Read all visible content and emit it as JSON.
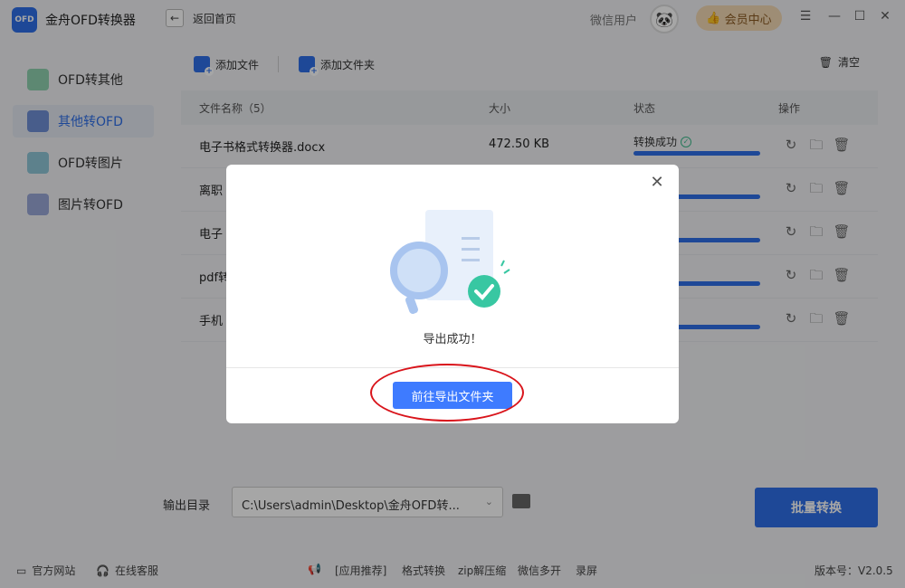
{
  "app": {
    "title": "金舟OFD转换器",
    "logo_text": "OFD"
  },
  "header": {
    "back_label": "返回首页",
    "user_name": "微信用户",
    "vip_label": "会员中心"
  },
  "sidebar": {
    "items": [
      {
        "label": "OFD转其他",
        "active": false
      },
      {
        "label": "其他转OFD",
        "active": true
      },
      {
        "label": "OFD转图片",
        "active": false
      },
      {
        "label": "图片转OFD",
        "active": false
      }
    ]
  },
  "toolbar": {
    "add_file": "添加文件",
    "add_folder": "添加文件夹",
    "clear": "清空"
  },
  "table": {
    "headers": {
      "name": "文件名称（5）",
      "size": "大小",
      "status": "状态",
      "ops": "操作"
    },
    "rows": [
      {
        "name": "电子书格式转换器.docx",
        "size": "472.50 KB",
        "status": "转换成功",
        "progress": 1.0
      },
      {
        "name": "离职",
        "size": "",
        "status": "",
        "progress": 1.0
      },
      {
        "name": "电子",
        "size": "",
        "status": "",
        "progress": 1.0
      },
      {
        "name": "pdf转",
        "size": "",
        "status": "",
        "progress": 1.0
      },
      {
        "name": "手机",
        "size": "",
        "status": "",
        "progress": 1.0
      }
    ]
  },
  "output": {
    "label": "输出目录",
    "path": "C:\\Users\\admin\\Desktop\\金舟OFD转...",
    "batch_btn": "批量转换"
  },
  "footer": {
    "website": "官方网站",
    "service": "在线客服",
    "recommend": "[应用推荐]",
    "recs": [
      "格式转换",
      "zip解压缩",
      "微信多开",
      "录屏"
    ],
    "version": "版本号：V2.0.5"
  },
  "modal": {
    "message": "导出成功！",
    "button": "前往导出文件夹"
  },
  "colors": {
    "accent": "#2f6fe8",
    "success": "#3cba8c",
    "highlight": "#d9141b"
  }
}
